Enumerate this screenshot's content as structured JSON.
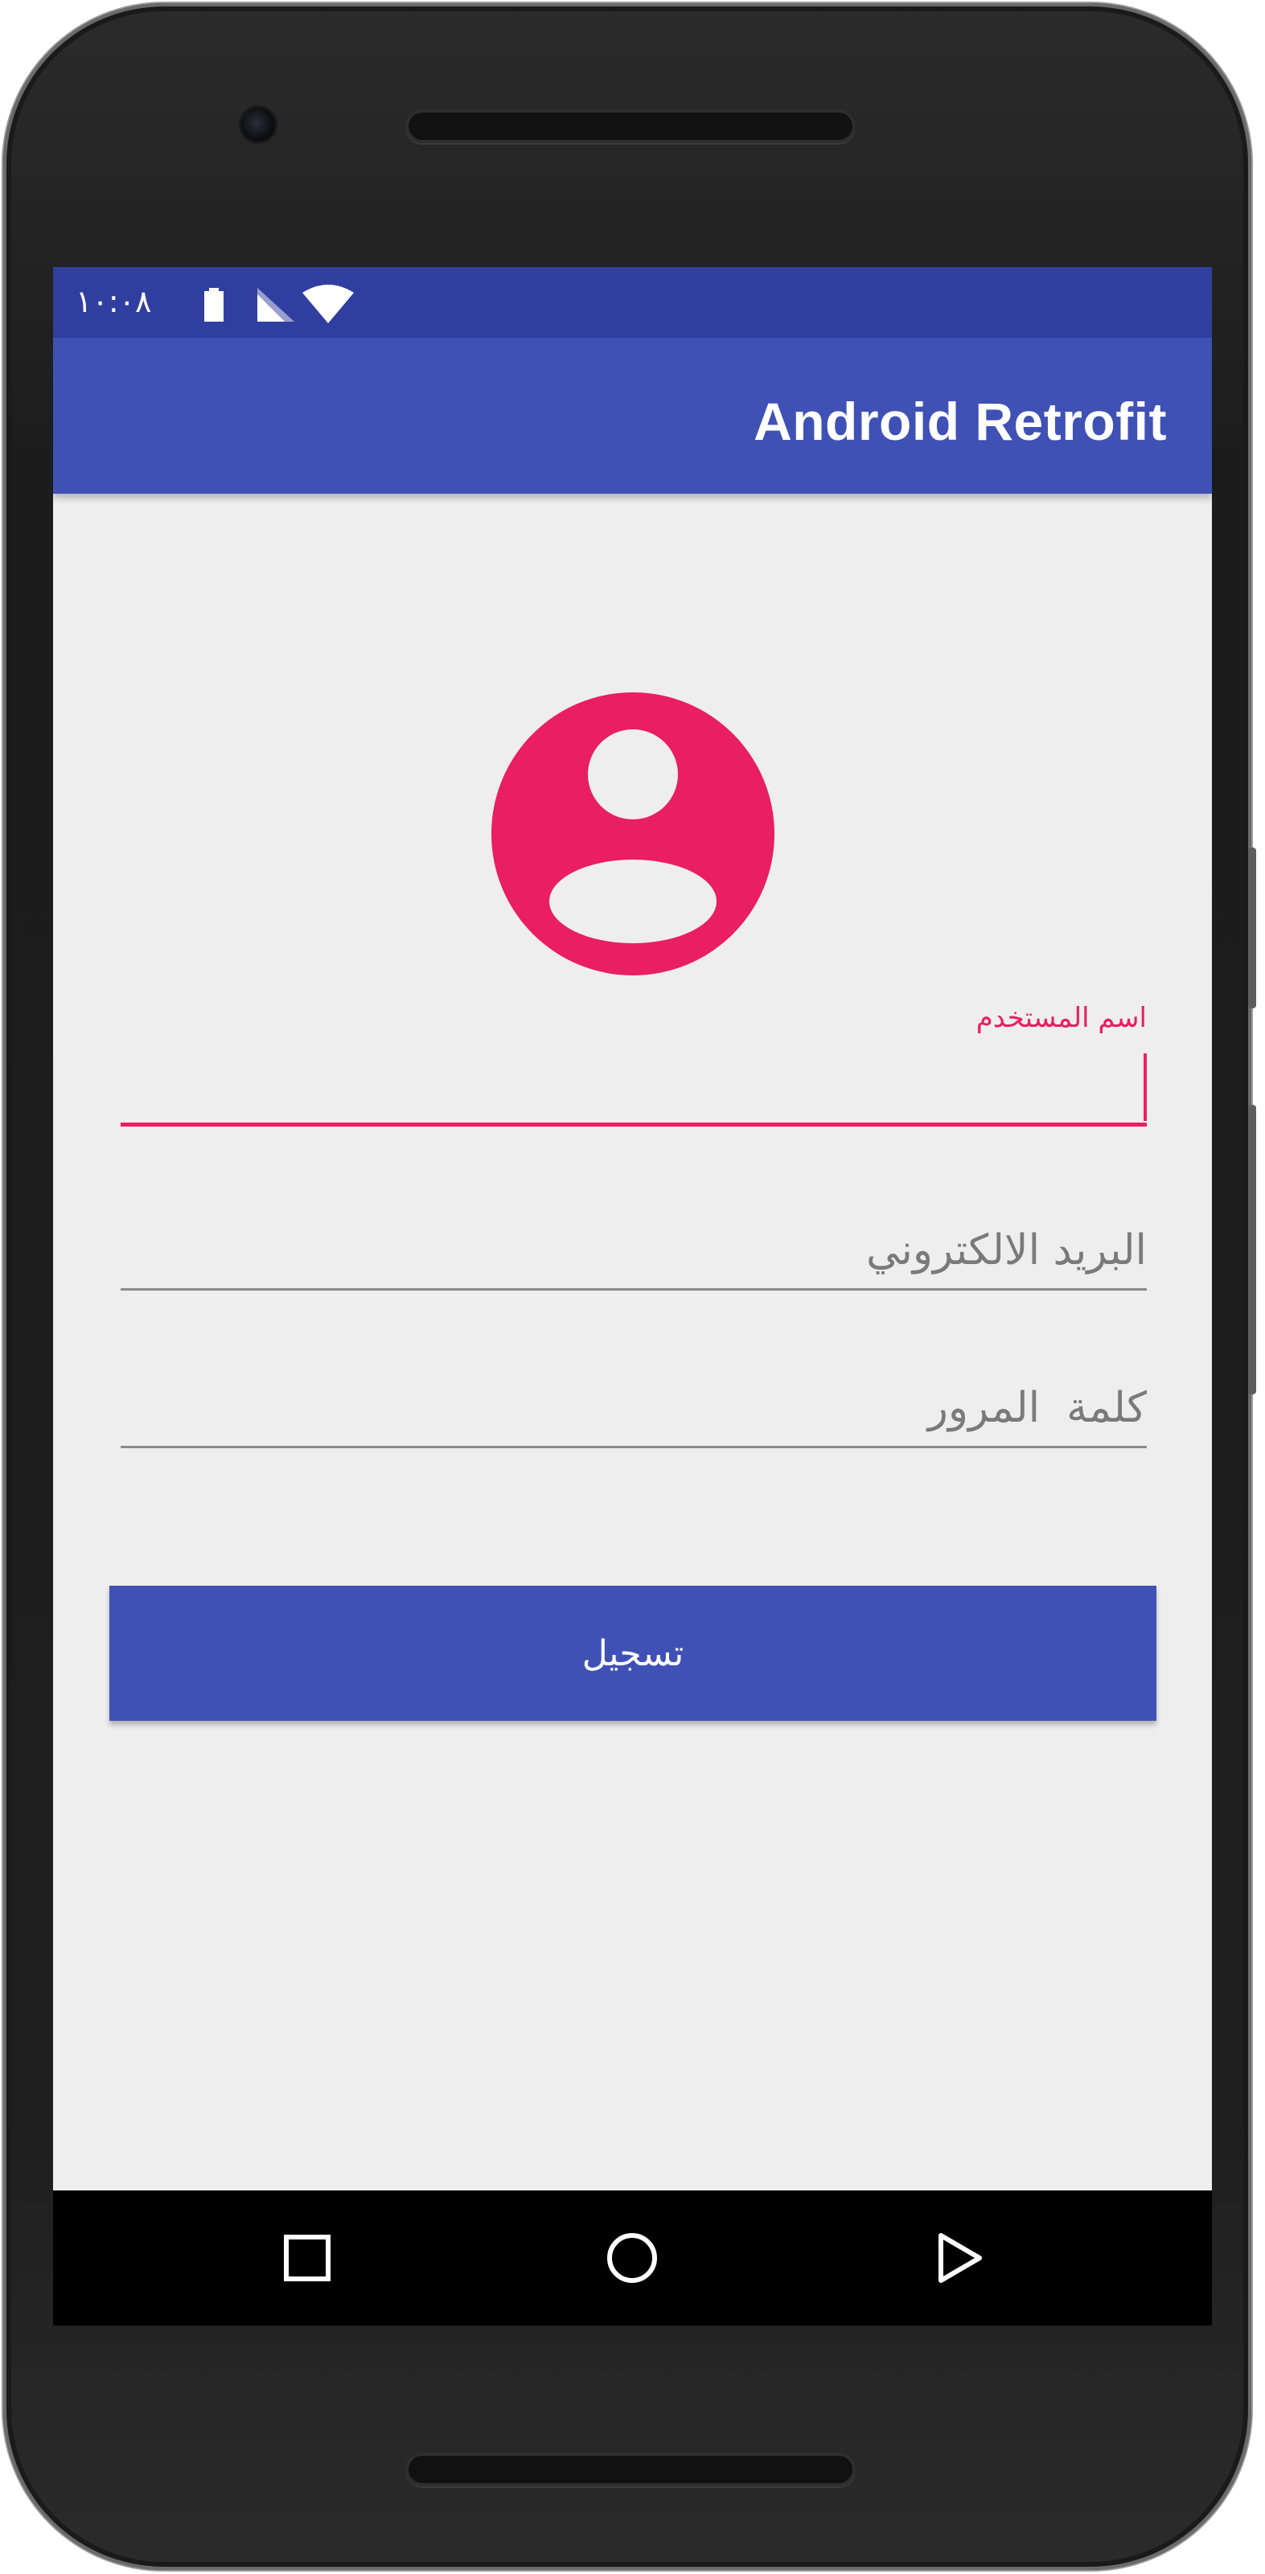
{
  "status_bar": {
    "time": "١٠:٠٨",
    "icons": [
      "battery-icon",
      "signal-icon",
      "wifi-icon"
    ]
  },
  "app_bar": {
    "title": "Android Retrofit"
  },
  "avatar": {
    "icon": "account-circle-icon",
    "color": "#e91e63"
  },
  "form": {
    "username": {
      "label": "اسم المستخدم",
      "value": ""
    },
    "email": {
      "placeholder": "البريد الالكتروني",
      "value": ""
    },
    "password": {
      "placeholder": "كلمة  المرور",
      "value": ""
    },
    "submit_label": "تسجيل"
  },
  "nav_bar": {
    "buttons": [
      "recents-icon",
      "home-icon",
      "back-icon"
    ]
  },
  "colors": {
    "primary": "#3f51b5",
    "primary_dark": "#303f9f",
    "accent": "#e91e63",
    "background": "#eeeeee"
  }
}
